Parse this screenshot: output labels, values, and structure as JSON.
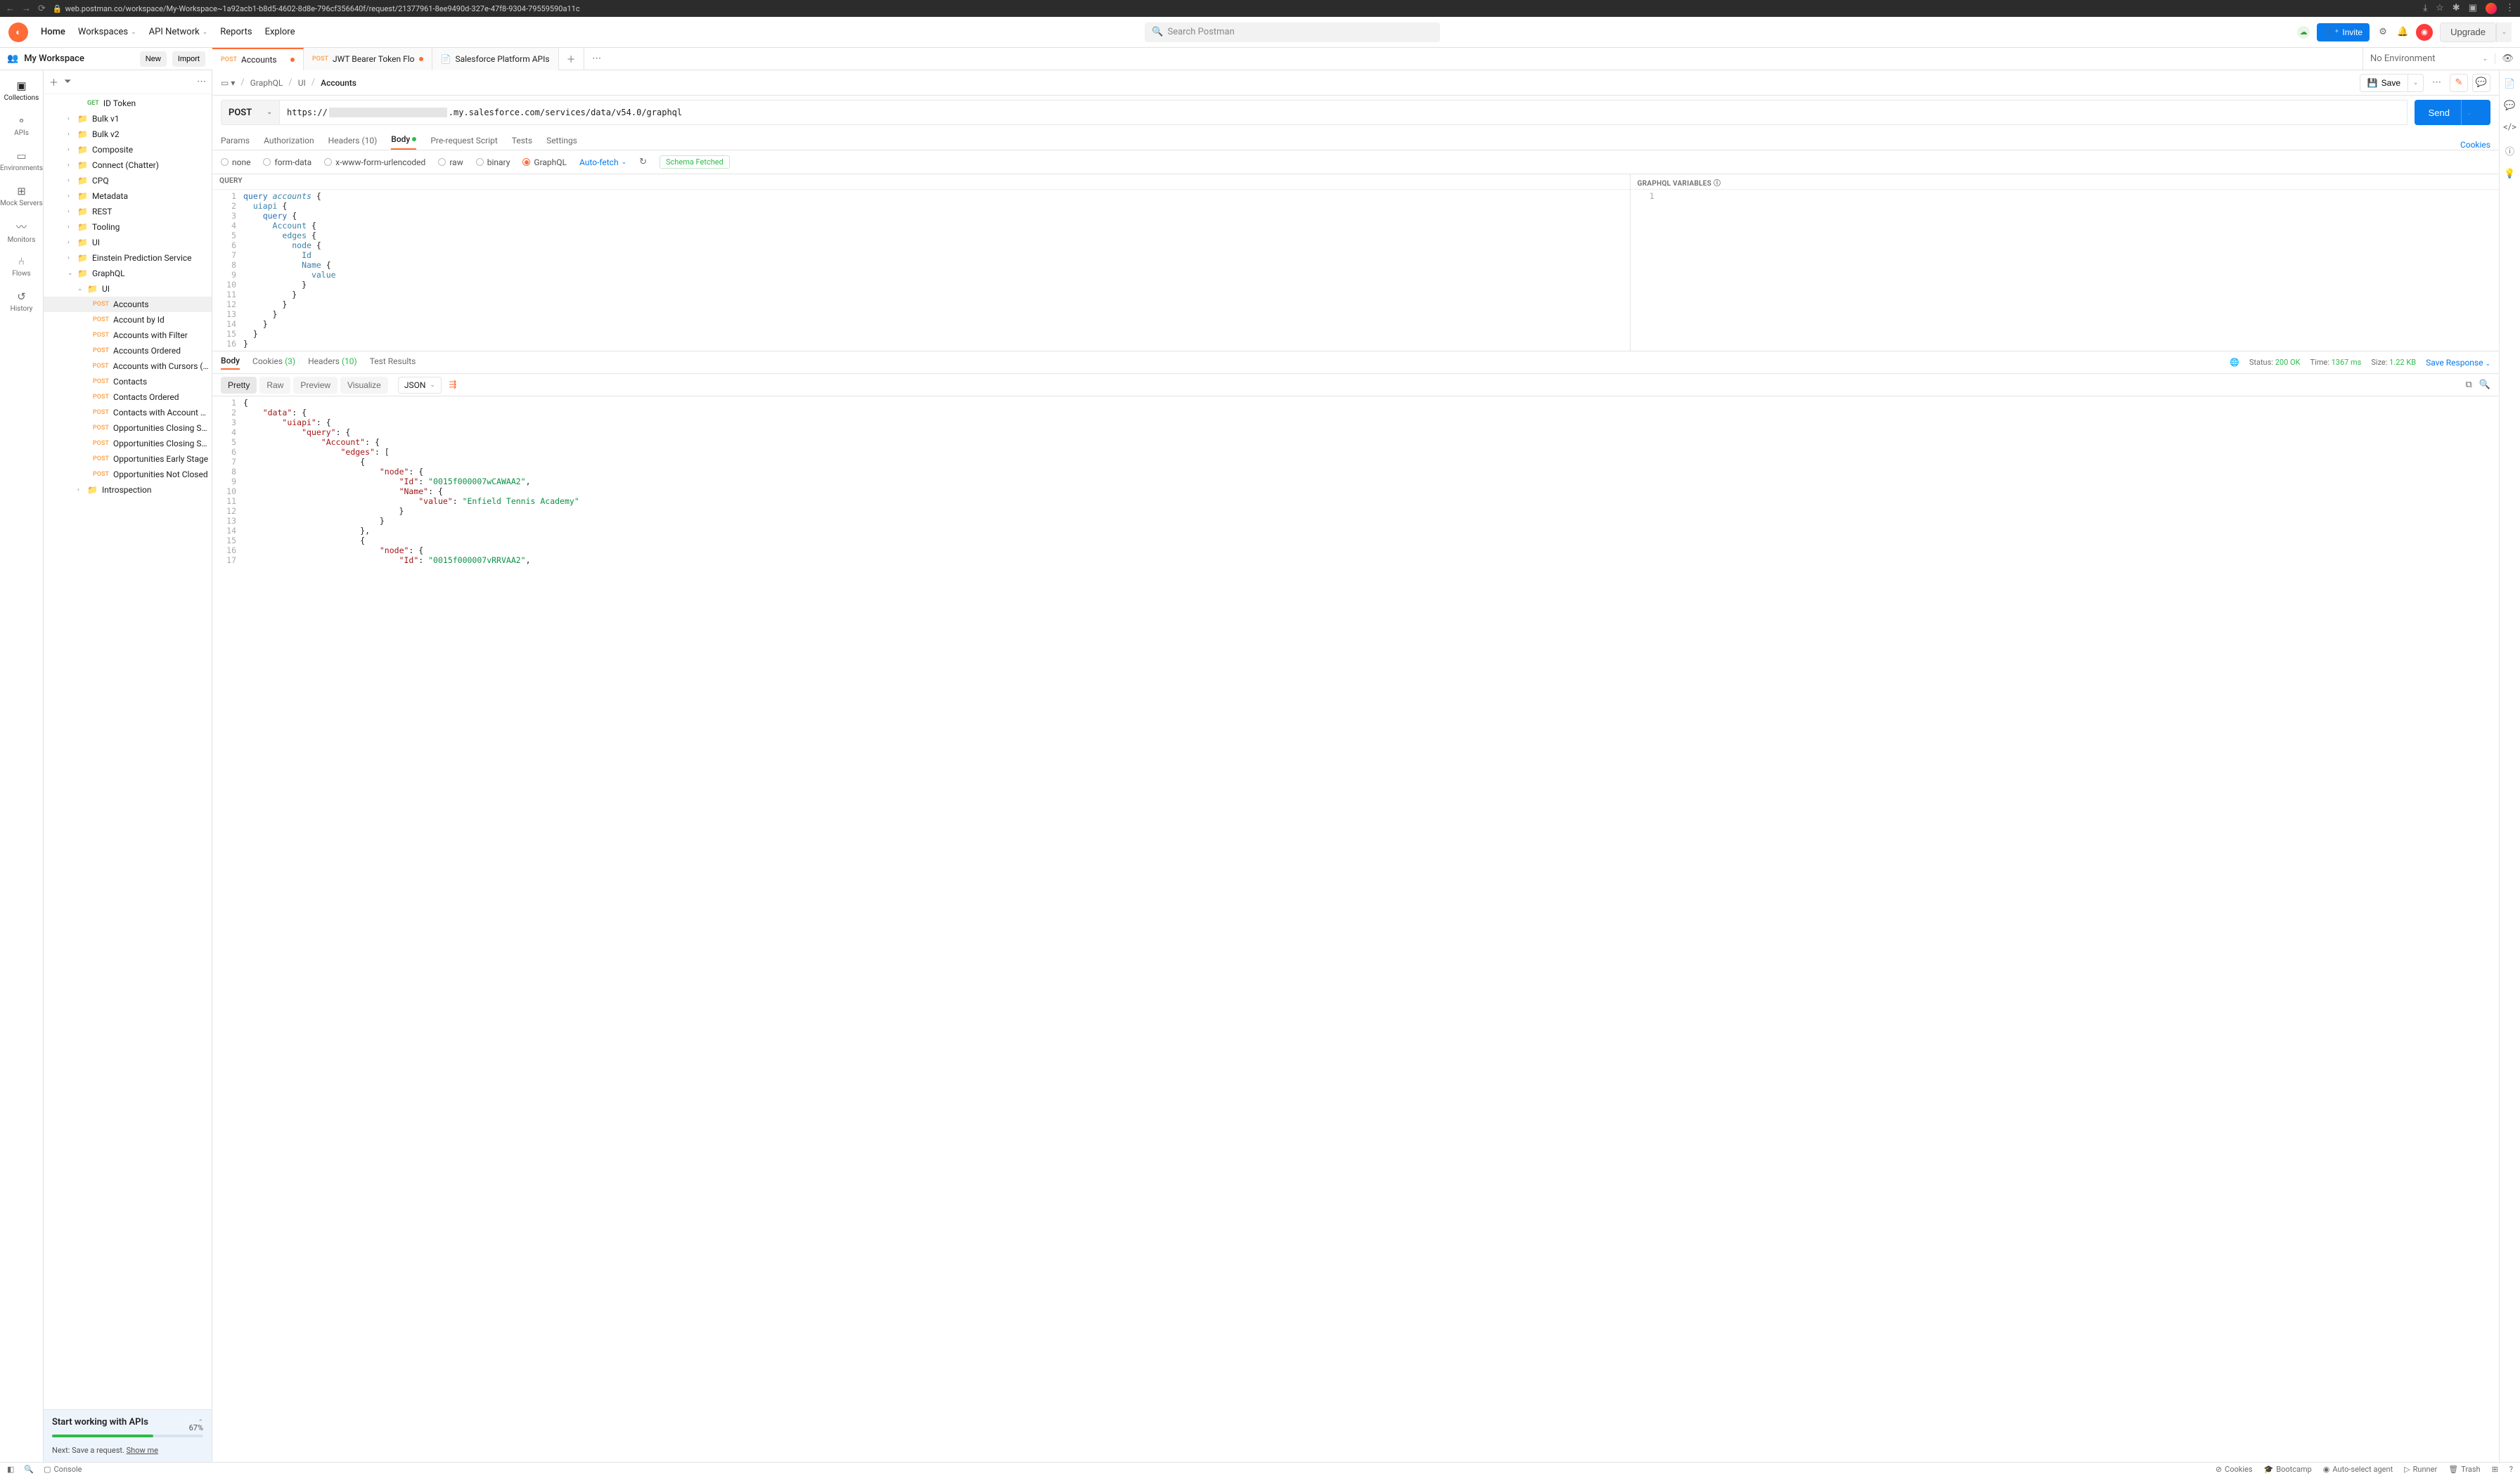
{
  "browser": {
    "url": "web.postman.co/workspace/My-Workspace~1a92acb1-b8d5-4602-8d8e-796cf356640f/request/21377961-8ee9490d-327e-47f8-9304-79559590a11c"
  },
  "topnav": {
    "home": "Home",
    "workspaces": "Workspaces",
    "apinetwork": "API Network",
    "reports": "Reports",
    "explore": "Explore",
    "search_placeholder": "Search Postman",
    "invite": "Invite",
    "upgrade": "Upgrade"
  },
  "workspace": {
    "name": "My Workspace",
    "new": "New",
    "import": "Import"
  },
  "tabs": [
    {
      "method": "POST",
      "mclass": "method-post",
      "label": "Accounts",
      "active": true,
      "unsaved": true,
      "icon": ""
    },
    {
      "method": "POST",
      "mclass": "method-post",
      "label": "JWT Bearer Token Flo",
      "active": false,
      "unsaved": true,
      "icon": ""
    },
    {
      "method": "",
      "mclass": "",
      "label": "Salesforce Platform APIs",
      "active": false,
      "unsaved": false,
      "icon": "📄"
    }
  ],
  "env": {
    "label": "No Environment"
  },
  "rail": [
    {
      "icon": "▣",
      "label": "Collections",
      "active": true
    },
    {
      "icon": "⚬",
      "label": "APIs",
      "active": false
    },
    {
      "icon": "▭",
      "label": "Environments",
      "active": false
    },
    {
      "icon": "⊞",
      "label": "Mock Servers",
      "active": false
    },
    {
      "icon": "〰",
      "label": "Monitors",
      "active": false
    },
    {
      "icon": "⑃",
      "label": "Flows",
      "active": false
    },
    {
      "icon": "↺",
      "label": "History",
      "active": false
    }
  ],
  "tree": [
    {
      "indent": 3,
      "method": "GET",
      "mclass": "method-get",
      "label": "ID Token",
      "chev": ""
    },
    {
      "indent": 2,
      "chev": "›",
      "folder": true,
      "label": "Bulk v1"
    },
    {
      "indent": 2,
      "chev": "›",
      "folder": true,
      "label": "Bulk v2"
    },
    {
      "indent": 2,
      "chev": "›",
      "folder": true,
      "label": "Composite"
    },
    {
      "indent": 2,
      "chev": "›",
      "folder": true,
      "label": "Connect (Chatter)"
    },
    {
      "indent": 2,
      "chev": "›",
      "folder": true,
      "label": "CPQ"
    },
    {
      "indent": 2,
      "chev": "›",
      "folder": true,
      "label": "Metadata"
    },
    {
      "indent": 2,
      "chev": "›",
      "folder": true,
      "label": "REST"
    },
    {
      "indent": 2,
      "chev": "›",
      "folder": true,
      "label": "Tooling"
    },
    {
      "indent": 2,
      "chev": "›",
      "folder": true,
      "label": "UI"
    },
    {
      "indent": 2,
      "chev": "›",
      "folder": true,
      "label": "Einstein Prediction Service"
    },
    {
      "indent": 2,
      "chev": "⌄",
      "folder": true,
      "label": "GraphQL"
    },
    {
      "indent": 3,
      "chev": "⌄",
      "folder": true,
      "label": "UI"
    },
    {
      "indent": 4,
      "method": "POST",
      "mclass": "method-post",
      "label": "Accounts",
      "selected": true
    },
    {
      "indent": 4,
      "method": "POST",
      "mclass": "method-post",
      "label": "Account by Id"
    },
    {
      "indent": 4,
      "method": "POST",
      "mclass": "method-post",
      "label": "Accounts with Filter"
    },
    {
      "indent": 4,
      "method": "POST",
      "mclass": "method-post",
      "label": "Accounts Ordered"
    },
    {
      "indent": 4,
      "method": "POST",
      "mclass": "method-post",
      "label": "Accounts with Cursors (P...)"
    },
    {
      "indent": 4,
      "method": "POST",
      "mclass": "method-post",
      "label": "Contacts"
    },
    {
      "indent": 4,
      "method": "POST",
      "mclass": "method-post",
      "label": "Contacts Ordered"
    },
    {
      "indent": 4,
      "method": "POST",
      "mclass": "method-post",
      "label": "Contacts with Account N..."
    },
    {
      "indent": 4,
      "method": "POST",
      "mclass": "method-post",
      "label": "Opportunities Closing So..."
    },
    {
      "indent": 4,
      "method": "POST",
      "mclass": "method-post",
      "label": "Opportunities Closing So..."
    },
    {
      "indent": 4,
      "method": "POST",
      "mclass": "method-post",
      "label": "Opportunities Early Stage"
    },
    {
      "indent": 4,
      "method": "POST",
      "mclass": "method-post",
      "label": "Opportunities Not Closed"
    },
    {
      "indent": 3,
      "chev": "›",
      "folder": true,
      "label": "Introspection"
    }
  ],
  "progress": {
    "title": "Start working with APIs",
    "pct": "67%",
    "pct_val": 67,
    "next": "Next: Save a request. ",
    "show_me": "Show me"
  },
  "breadcrumb": {
    "parts": [
      "GraphQL",
      "UI"
    ],
    "current": "Accounts",
    "save": "Save"
  },
  "request": {
    "method": "POST",
    "url_prefix": "https://",
    "url_suffix": ".my.salesforce.com/services/data/v54.0/graphql",
    "send": "Send"
  },
  "reqtabs": {
    "params": "Params",
    "authorization": "Authorization",
    "headers": "Headers",
    "headers_count": "(10)",
    "body": "Body",
    "prerequest": "Pre-request Script",
    "tests": "Tests",
    "settings": "Settings",
    "cookies": "Cookies"
  },
  "bodytype": {
    "none": "none",
    "formdata": "form-data",
    "urlencoded": "x-www-form-urlencoded",
    "raw": "raw",
    "binary": "binary",
    "graphql": "GraphQL",
    "autofetch": "Auto-fetch",
    "schema_fetched": "Schema Fetched"
  },
  "querypane": {
    "title": "QUERY",
    "vars_title": "GRAPHQL VARIABLES"
  },
  "query_lines": [
    {
      "n": "1",
      "html": "<span class='kw'>query</span> <span class='fn'>accounts</span> {"
    },
    {
      "n": "2",
      "html": "  <span class='field'>uiapi</span> {"
    },
    {
      "n": "3",
      "html": "    <span class='kw'>query</span> {"
    },
    {
      "n": "4",
      "html": "      <span class='field'>Account</span> {"
    },
    {
      "n": "5",
      "html": "        <span class='field'>edges</span> {"
    },
    {
      "n": "6",
      "html": "          <span class='field'>node</span> {"
    },
    {
      "n": "7",
      "html": "            <span class='field'>Id</span>"
    },
    {
      "n": "8",
      "html": "            <span class='field'>Name</span> {"
    },
    {
      "n": "9",
      "html": "              <span class='field'>value</span>"
    },
    {
      "n": "10",
      "html": "            }"
    },
    {
      "n": "11",
      "html": "          }"
    },
    {
      "n": "12",
      "html": "        }"
    },
    {
      "n": "13",
      "html": "      }"
    },
    {
      "n": "14",
      "html": "    }"
    },
    {
      "n": "15",
      "html": "  }"
    },
    {
      "n": "16",
      "html": "}"
    }
  ],
  "vars_lines": [
    {
      "n": "1",
      "html": ""
    }
  ],
  "resptabs": {
    "body": "Body",
    "cookies": "Cookies",
    "cookies_count": "(3)",
    "headers": "Headers",
    "headers_count": "(10)",
    "test_results": "Test Results",
    "status_label": "Status:",
    "status_val": "200 OK",
    "time_label": "Time:",
    "time_val": "1367 ms",
    "size_label": "Size:",
    "size_val": "1.22 KB",
    "save_response": "Save Response"
  },
  "resptoolbar": {
    "pretty": "Pretty",
    "raw": "Raw",
    "preview": "Preview",
    "visualize": "Visualize",
    "json": "JSON"
  },
  "response_lines": [
    {
      "n": "1",
      "html": "{",
      "indent": 0
    },
    {
      "n": "2",
      "html": "    <span class='prop'>\"data\"</span>: {",
      "indent": 0
    },
    {
      "n": "3",
      "html": "        <span class='prop'>\"uiapi\"</span>: {",
      "indent": 0
    },
    {
      "n": "4",
      "html": "            <span class='prop'>\"query\"</span>: {",
      "indent": 0
    },
    {
      "n": "5",
      "html": "                <span class='prop'>\"Account\"</span>: {",
      "indent": 0
    },
    {
      "n": "6",
      "html": "                    <span class='prop'>\"edges\"</span>: [",
      "indent": 0
    },
    {
      "n": "7",
      "html": "                        {",
      "indent": 0
    },
    {
      "n": "8",
      "html": "                            <span class='prop'>\"node\"</span>: {",
      "indent": 0
    },
    {
      "n": "9",
      "html": "                                <span class='prop'>\"Id\"</span>: <span class='str'>\"0015f000007wCAWAA2\"</span>,",
      "indent": 0
    },
    {
      "n": "10",
      "html": "                                <span class='prop'>\"Name\"</span>: {",
      "indent": 0
    },
    {
      "n": "11",
      "html": "                                    <span class='prop'>\"value\"</span>: <span class='str'>\"Enfield Tennis Academy\"</span>",
      "indent": 0
    },
    {
      "n": "12",
      "html": "                                }",
      "indent": 0
    },
    {
      "n": "13",
      "html": "                            }",
      "indent": 0
    },
    {
      "n": "14",
      "html": "                        },",
      "indent": 0
    },
    {
      "n": "15",
      "html": "                        {",
      "indent": 0
    },
    {
      "n": "16",
      "html": "                            <span class='prop'>\"node\"</span>: {",
      "indent": 0
    },
    {
      "n": "17",
      "html": "                                <span class='prop'>\"Id\"</span>: <span class='str'>\"0015f000007vRRVAA2\"</span>,",
      "indent": 0
    }
  ],
  "statusbar": {
    "console": "Console",
    "cookies": "Cookies",
    "bootcamp": "Bootcamp",
    "autoselect": "Auto-select agent",
    "runner": "Runner",
    "trash": "Trash"
  }
}
